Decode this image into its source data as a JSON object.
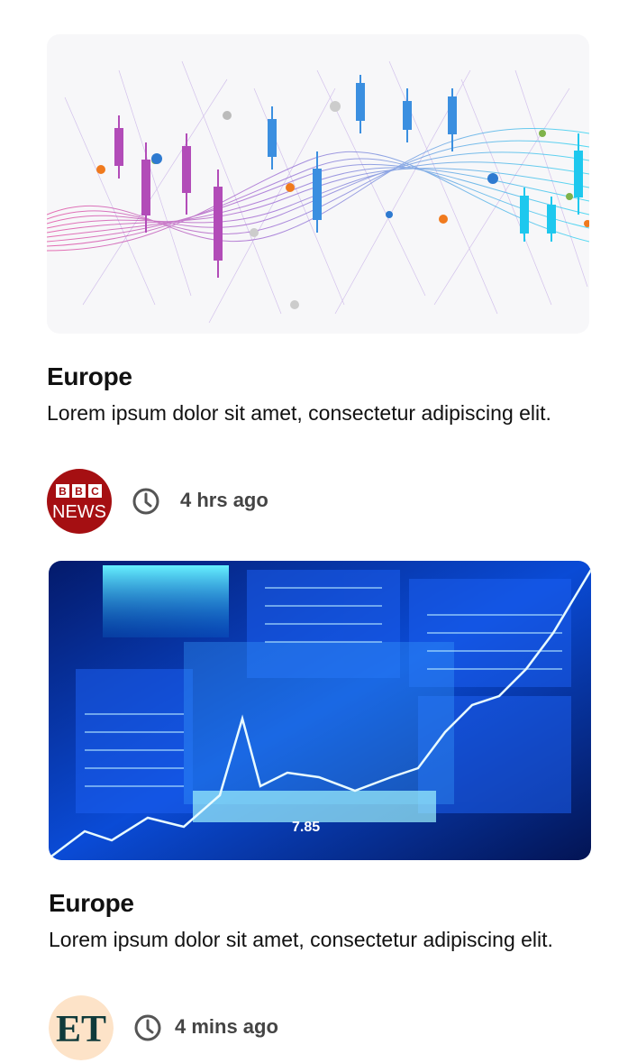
{
  "articles": [
    {
      "image": "stock-network-candlestick-illustration",
      "title": "Europe",
      "description": "Lorem ipsum dolor sit amet, consectetur adipiscing elit.",
      "source": {
        "logo": "bbc-news-logo",
        "brand_top": "BBC",
        "brand_bottom": "NEWS",
        "color": "#a50f12"
      },
      "clock_icon": "clock-icon",
      "time": "4 hrs ago"
    },
    {
      "image": "stock-market-board-blue",
      "title": "Europe",
      "description": "Lorem ipsum dolor sit amet, consectetur adipiscing elit.",
      "source": {
        "logo": "economic-times-logo",
        "brand": "ET",
        "color": "#fde3c8"
      },
      "clock_icon": "clock-icon",
      "time": "4 mins ago"
    }
  ],
  "colors": {
    "text": "#111111",
    "meta": "#444444",
    "bbc_red": "#a50f12",
    "et_peach": "#fde3c8"
  }
}
